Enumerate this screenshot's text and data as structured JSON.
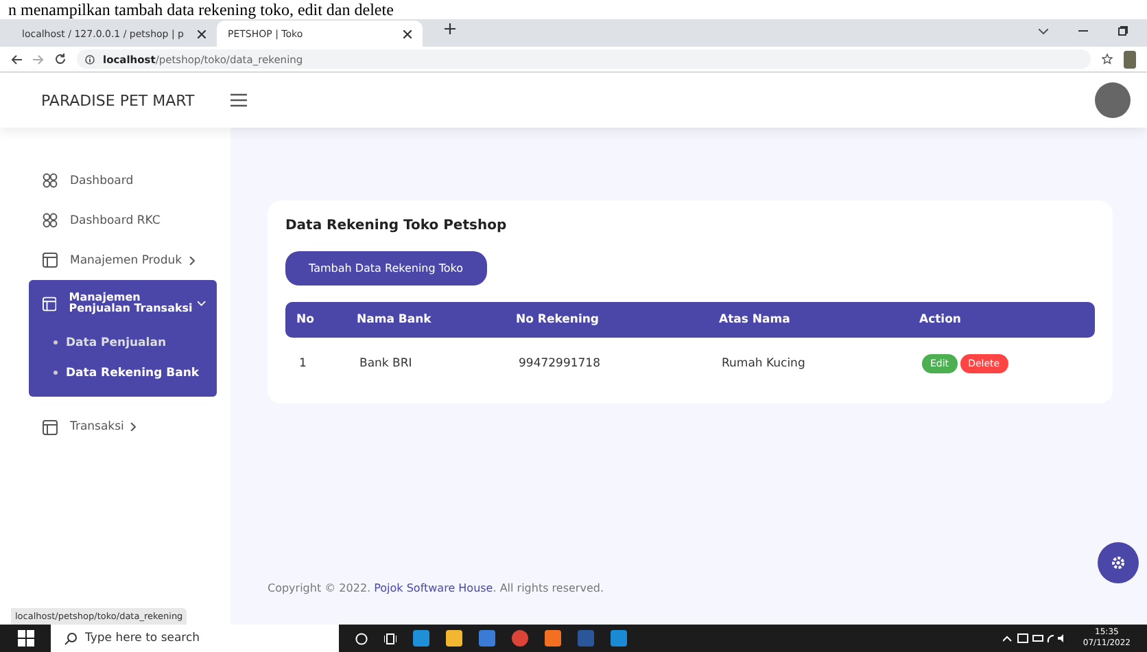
{
  "caption": "n menampilkan tambah data rekening toko, edit dan delete",
  "browser": {
    "tabs": [
      {
        "title": "localhost / 127.0.0.1 / petshop | p",
        "selected": false
      },
      {
        "title": "PETSHOP | Toko",
        "selected": true
      }
    ],
    "url_host": "localhost",
    "url_path": "/petshop/toko/data_rekening"
  },
  "app": {
    "brand": "PARADISE PET MART"
  },
  "sidebar": {
    "items": [
      {
        "label": "Dashboard",
        "kind": "grid",
        "expanded": false,
        "collapsible": false
      },
      {
        "label": "Dashboard RKC",
        "kind": "grid",
        "expanded": false,
        "collapsible": false
      },
      {
        "label": "Manajemen Produk",
        "kind": "layout",
        "expanded": false,
        "collapsible": true
      },
      {
        "label": "Manajemen Penjualan Transaksi",
        "kind": "layout",
        "expanded": true,
        "collapsible": true,
        "children": [
          {
            "label": "Data Penjualan",
            "selected": false
          },
          {
            "label": "Data Rekening Bank",
            "selected": true
          }
        ]
      },
      {
        "label": "Transaksi",
        "kind": "layout",
        "expanded": false,
        "collapsible": true
      }
    ]
  },
  "card": {
    "title": "Data Rekening Toko Petshop",
    "add_button": "Tambah Data Rekening Toko",
    "table": {
      "columns": [
        "No",
        "Nama Bank",
        "No Rekening",
        "Atas Nama",
        "Action"
      ],
      "rows": [
        {
          "no": "1",
          "bank": "Bank BRI",
          "account": "99472991718",
          "name": "Rumah Kucing",
          "actions": [
            "Edit",
            "Delete"
          ]
        }
      ]
    }
  },
  "footer": {
    "prefix": "Copyright © 2022.",
    "link": "Pojok Software House",
    "suffix": ". All rights reserved."
  },
  "status_link": "localhost/petshop/toko/data_rekening",
  "taskbar": {
    "search_placeholder": "Type here to search",
    "time": "15:35",
    "date": "07/11/2022"
  }
}
